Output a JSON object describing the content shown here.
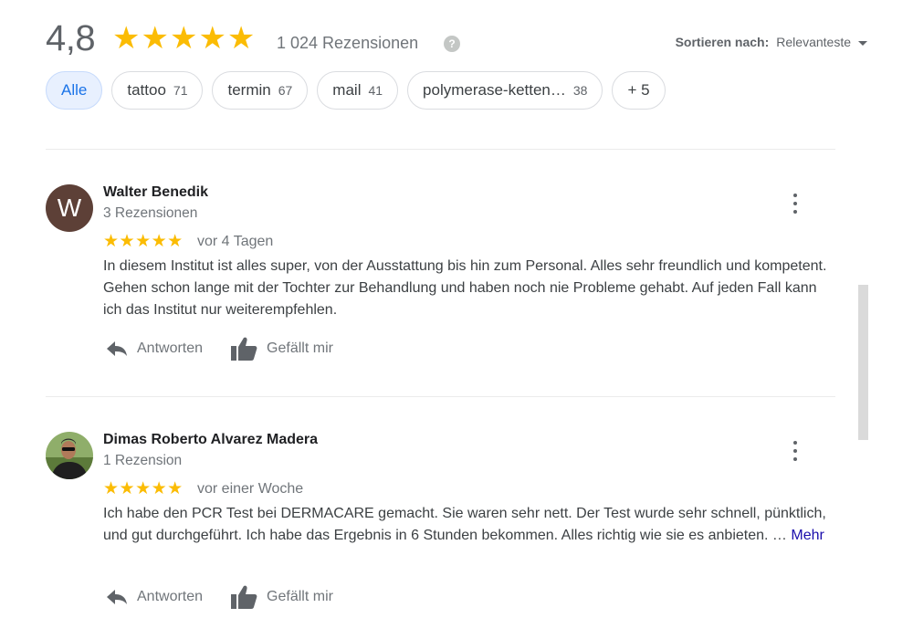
{
  "summary": {
    "rating": "4,8",
    "stars": "★★★★★",
    "review_count": "1 024 Rezensionen",
    "help_glyph": "?",
    "sort_label": "Sortieren nach:",
    "sort_value": "Relevanteste"
  },
  "chips": [
    {
      "label": "Alle",
      "count": ""
    },
    {
      "label": "tattoo",
      "count": "71"
    },
    {
      "label": "termin",
      "count": "67"
    },
    {
      "label": "mail",
      "count": "41"
    },
    {
      "label": "polymerase-ketten…",
      "count": "38"
    },
    {
      "label": "+ 5",
      "count": ""
    }
  ],
  "reviews": [
    {
      "avatar_letter": "W",
      "name": "Walter Benedik",
      "meta": "3 Rezensionen",
      "stars": "★★★★★",
      "rating": 5,
      "date": "vor 4 Tagen",
      "text": "In diesem Institut ist alles super, von der Ausstattung bis hin zum Personal. Alles sehr freundlich und kompetent. Gehen schon lange mit der Tochter zur Behandlung und haben noch nie Probleme gehabt. Auf jeden Fall kann ich das Institut nur weiterempfehlen.",
      "more": "",
      "reply_label": "Antworten",
      "like_label": "Gefällt mir"
    },
    {
      "avatar_letter": "",
      "name": "Dimas Roberto Alvarez Madera",
      "meta": "1 Rezension",
      "stars": "★★★★★",
      "rating": 5,
      "date": "vor einer Woche",
      "text": "Ich habe den PCR Test bei DERMACARE gemacht. Sie waren sehr nett. Der Test wurde sehr schnell, pünktlich, und gut durchgeführt. Ich habe das Ergebnis in 6 Stunden bekommen. Alles richtig wie sie es anbieten. …",
      "more": "Mehr",
      "reply_label": "Antworten",
      "like_label": "Gefällt mir"
    }
  ],
  "colors": {
    "star": "#fbbc04",
    "active_chip_bg": "#e8f0fe",
    "active_chip_text": "#1a73e8",
    "link": "#1a0dab",
    "avatar_w": "#5d4037"
  },
  "icons": {
    "reply": "reply-arrow-icon",
    "like": "thumbs-up-icon",
    "menu": "more-vert-icon",
    "help": "help-circle-icon",
    "sort": "caret-down-icon"
  }
}
